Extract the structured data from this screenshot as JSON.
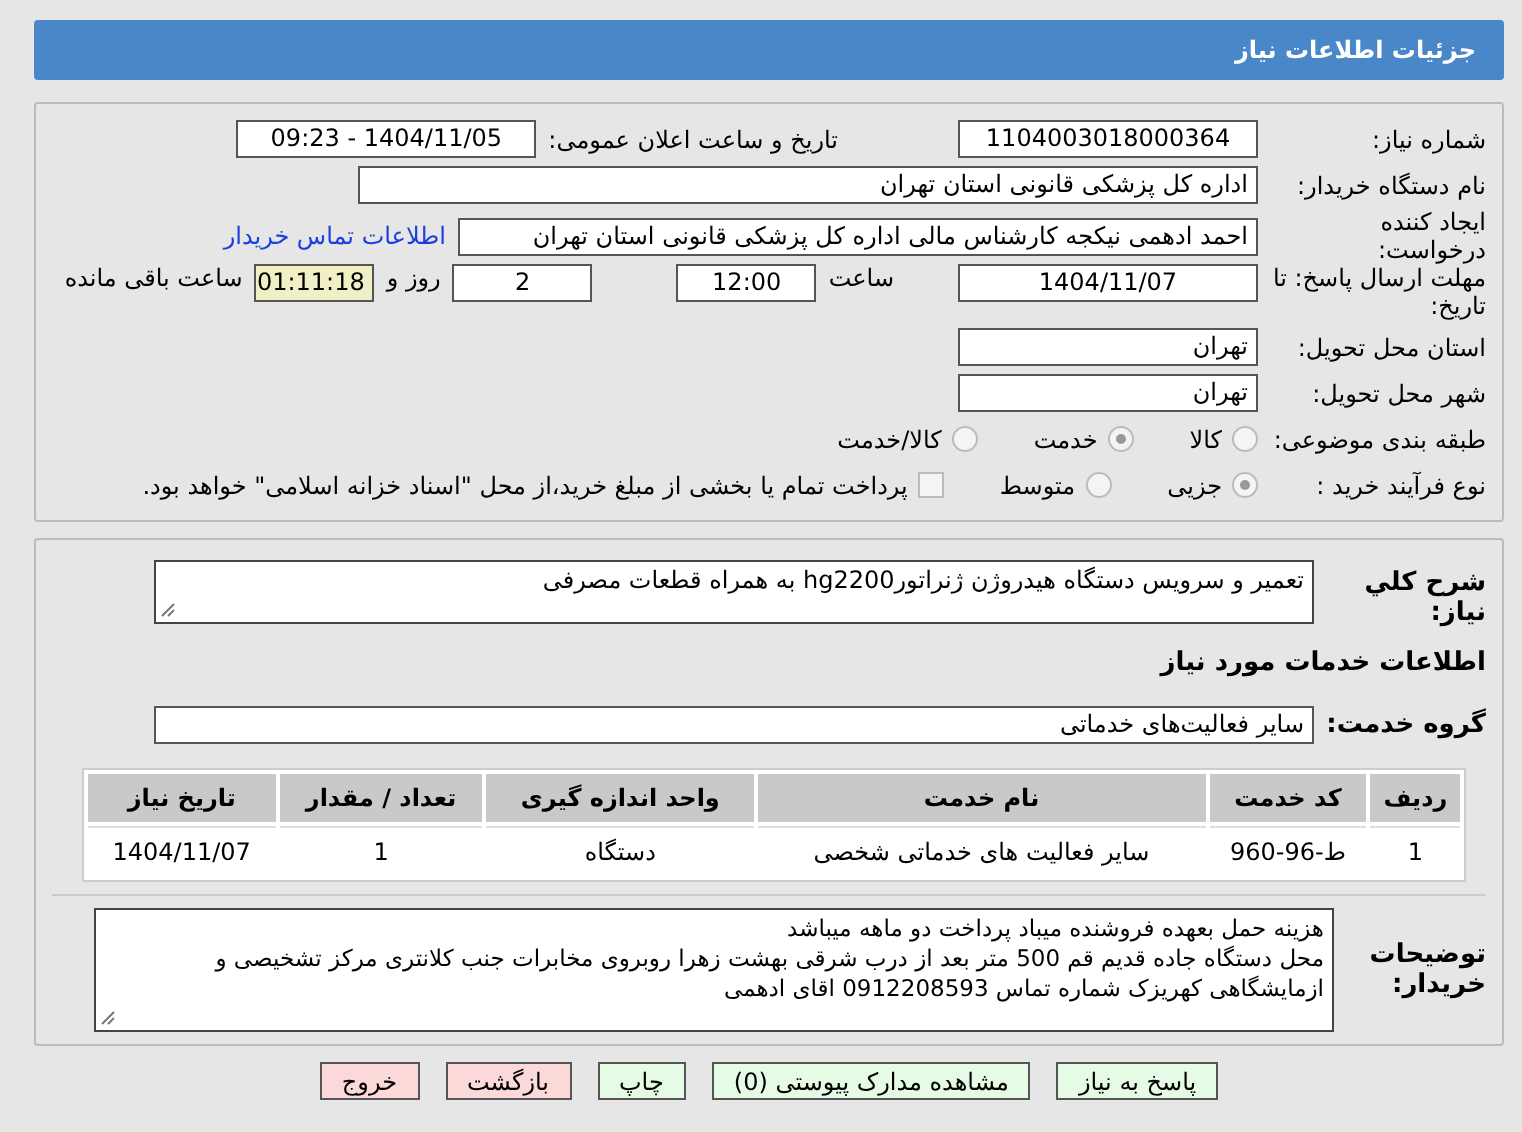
{
  "header": {
    "title": "جزئیات اطلاعات نیاز"
  },
  "need_number": {
    "label": "شماره نیاز:",
    "value": "1104003018000364"
  },
  "announce": {
    "label": "تاریخ و ساعت اعلان عمومی:",
    "value": "1404/11/05 - 09:23"
  },
  "buyer": {
    "label": "نام دستگاه خریدار:",
    "value": "اداره کل پزشکی قانونی استان تهران"
  },
  "creator": {
    "label": "ایجاد کننده درخواست:",
    "value": "احمد ادهمی نیکجه کارشناس مالی اداره کل پزشکی قانونی استان تهران",
    "link": "اطلاعات تماس خریدار"
  },
  "deadline": {
    "label": "مهلت ارسال پاسخ: تا تاریخ:",
    "date": "1404/11/07",
    "time_label": "ساعت",
    "time": "12:00",
    "days": "2",
    "days_label": "روز و",
    "remaining": "01:11:18",
    "remaining_label": "ساعت باقی مانده"
  },
  "province": {
    "label": "استان محل تحویل:",
    "value": "تهران"
  },
  "city": {
    "label": "شهر محل تحویل:",
    "value": "تهران"
  },
  "category": {
    "label": "طبقه بندی موضوعی:",
    "options": [
      {
        "label": "کالا",
        "selected": false
      },
      {
        "label": "خدمت",
        "selected": true
      },
      {
        "label": "کالا/خدمت",
        "selected": false
      }
    ]
  },
  "purchase_type": {
    "label": "نوع فرآیند خرید :",
    "options": [
      {
        "kind": "radio",
        "label": "جزیی",
        "selected": true
      },
      {
        "kind": "radio",
        "label": "متوسط",
        "selected": false
      },
      {
        "kind": "checkbox",
        "label": "پرداخت تمام یا بخشی از مبلغ خرید،از محل \"اسناد خزانه اسلامی\" خواهد بود.",
        "checked": false
      }
    ]
  },
  "summary": {
    "label": "شرح کلي نياز:",
    "value": "تعمیر و سرویس دستگاه هیدروژن ژنراتورhg2200 به همراه قطعات مصرفی"
  },
  "services_heading": "اطلاعات خدمات مورد نیاز",
  "service_group": {
    "label": "گروه خدمت:",
    "value": "سایر فعالیت‌های خدماتی"
  },
  "table": {
    "columns": [
      "ردیف",
      "کد خدمت",
      "نام خدمت",
      "واحد اندازه گیری",
      "تعداد / مقدار",
      "تاریخ نیاز"
    ],
    "rows": [
      [
        "1",
        "ط-96-960",
        "سایر فعالیت های خدماتی شخصی",
        "دستگاه",
        "1",
        "1404/11/07"
      ]
    ]
  },
  "notes": {
    "label": "توضیحات خریدار:",
    "lines": [
      "هزینه حمل بعهده فروشنده میباد پرداخت دو ماهه میباشد",
      "محل دستگاه جاده قدیم قم 500 متر بعد از درب شرقی بهشت زهرا روبروی مخابرات جنب کلانتری مرکز تشخیصی و",
      "ازمایشگاهی کهریزک شماره تماس 0912208593 اقای ادهمی"
    ]
  },
  "buttons": [
    {
      "label": "پاسخ به نیاز",
      "kind": "action"
    },
    {
      "label": "مشاهده مدارک پیوستی (0)",
      "kind": "action"
    },
    {
      "label": "چاپ",
      "kind": "action"
    },
    {
      "label": "بازگشت",
      "kind": "exit"
    },
    {
      "label": "خروج",
      "kind": "exit"
    }
  ]
}
